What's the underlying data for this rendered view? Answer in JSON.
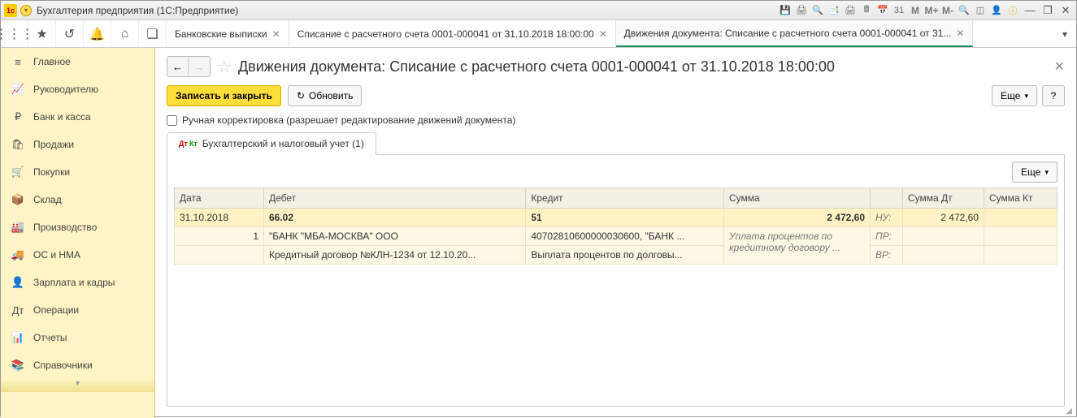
{
  "titlebar": {
    "app_title": "Бухгалтерия предприятия  (1С:Предприятие)",
    "icons": {
      "m": "M",
      "mplus": "M+",
      "mminus": "M-"
    }
  },
  "tabs": [
    {
      "label": "Банковские выписки"
    },
    {
      "label": "Списание с расчетного счета 0001-000041 от 31.10.2018 18:00:00"
    },
    {
      "label": "Движения документа: Списание с расчетного счета 0001-000041 от 31..."
    }
  ],
  "sidebar": {
    "items": [
      {
        "icon": "≡",
        "label": "Главное"
      },
      {
        "icon": "📈",
        "label": "Руководителю"
      },
      {
        "icon": "₽",
        "label": "Банк и касса"
      },
      {
        "icon": "🛍",
        "label": "Продажи"
      },
      {
        "icon": "🛒",
        "label": "Покупки"
      },
      {
        "icon": "📦",
        "label": "Склад"
      },
      {
        "icon": "🏭",
        "label": "Производство"
      },
      {
        "icon": "🚚",
        "label": "ОС и НМА"
      },
      {
        "icon": "👤",
        "label": "Зарплата и кадры"
      },
      {
        "icon": "Дт",
        "label": "Операции"
      },
      {
        "icon": "📊",
        "label": "Отчеты"
      },
      {
        "icon": "📚",
        "label": "Справочники"
      }
    ]
  },
  "content": {
    "title": "Движения документа: Списание с расчетного счета 0001-000041 от 31.10.2018 18:00:00",
    "btn_save": "Записать и закрыть",
    "btn_refresh": "Обновить",
    "btn_more": "Еще",
    "checkbox_label": "Ручная корректировка (разрешает редактирование движений документа)",
    "tab_label": "Бухгалтерский и налоговый учет (1)",
    "grid": {
      "headers": {
        "date": "Дата",
        "debit": "Дебет",
        "credit": "Кредит",
        "sum": "Сумма",
        "sum_dt": "Сумма Дт",
        "sum_kt": "Сумма Кт"
      },
      "row1": {
        "date": "31.10.2018",
        "debit": "66.02",
        "credit": "51",
        "sum": "2 472,60",
        "nu_label": "НУ:",
        "sum_dt": "2 472,60"
      },
      "row2": {
        "n": "1",
        "debit": "\"БАНК \"МБА-МОСКВА\" ООО",
        "credit": "40702810600000030600, \"БАНК ...",
        "desc": "Уплата процентов по кредитному договору ...",
        "pr_label": "ПР:"
      },
      "row3": {
        "debit": "Кредитный договор №КЛН-1234 от 12.10.20...",
        "credit": "Выплата процентов по долговы...",
        "vr_label": "ВР:"
      }
    }
  }
}
